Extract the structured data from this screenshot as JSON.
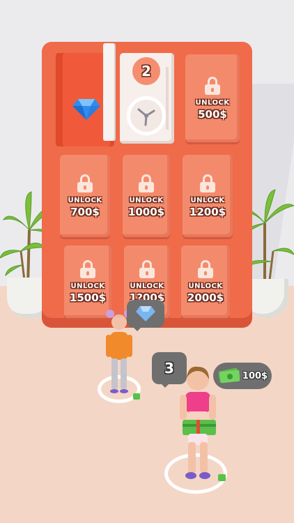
{
  "vault": {
    "level": "2"
  },
  "lockers": [
    {
      "unlock_label": "UNLOCK",
      "price": "500$"
    },
    {
      "unlock_label": "UNLOCK",
      "price": "700$"
    },
    {
      "unlock_label": "UNLOCK",
      "price": "1000$"
    },
    {
      "unlock_label": "UNLOCK",
      "price": "1200$"
    },
    {
      "unlock_label": "UNLOCK",
      "price": "1500$"
    },
    {
      "unlock_label": "UNLOCK",
      "price": "1?00$"
    },
    {
      "unlock_label": "UNLOCK",
      "price": "2000$"
    }
  ],
  "player": {
    "carry_count": "3",
    "cash_reward": "100$"
  },
  "npc": {
    "request_icon": "gem-icon"
  },
  "colors": {
    "cabinet": "#ef6b4a",
    "locker": "#f48a6c",
    "floor": "#f4d6c6",
    "progress": "#56c247",
    "diamond": "#2f8cf0"
  },
  "icons": {
    "lock": "padlock-icon",
    "diamond": "diamond-icon",
    "vault_dial": "vault-dial-icon",
    "cash": "cash-stack-icon"
  }
}
